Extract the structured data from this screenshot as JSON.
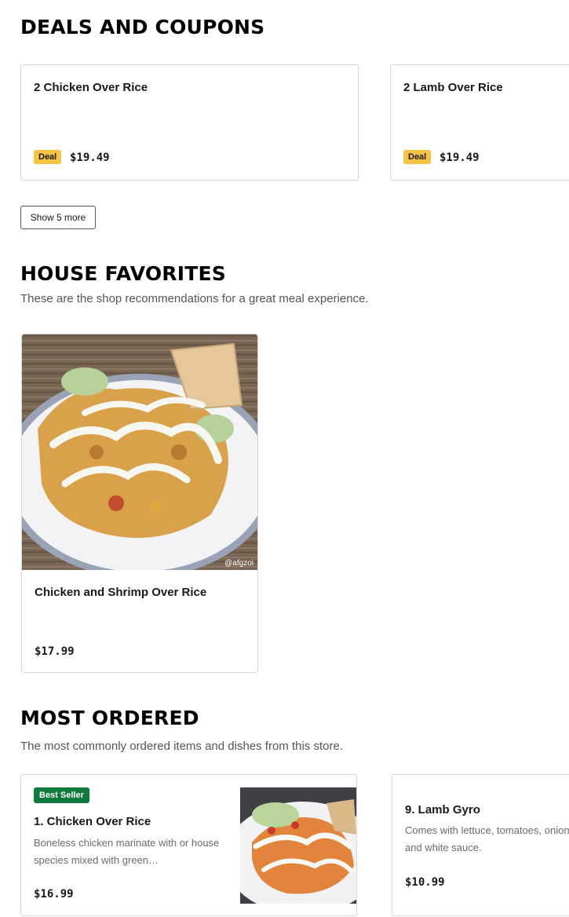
{
  "deals": {
    "title": "DEALS AND COUPONS",
    "items": [
      {
        "name": "2 Chicken Over Rice",
        "badge": "Deal",
        "price": "$19.49"
      },
      {
        "name": "2 Lamb Over Rice",
        "badge": "Deal",
        "price": "$19.49"
      }
    ],
    "show_more_label": "Show 5 more"
  },
  "house_favorites": {
    "title": "HOUSE FAVORITES",
    "subtitle": "These are the shop recommendations for a great meal experience.",
    "items": [
      {
        "name": "Chicken and Shrimp Over Rice",
        "price": "$17.99",
        "image_watermark": "@afgzoi"
      }
    ]
  },
  "most_ordered": {
    "title": "MOST ORDERED",
    "subtitle": "The most commonly ordered items and dishes from this store.",
    "items": [
      {
        "badge": "Best Seller",
        "name": "1. Chicken Over Rice",
        "description": "Boneless chicken marinate with or house species mixed with green…",
        "price": "$16.99"
      },
      {
        "name": "9. Lamb Gyro",
        "description": "Comes with lettuce, tomatoes, onions and white sauce.",
        "price": "$10.99"
      }
    ]
  },
  "colors": {
    "deal_badge": "#f6c343",
    "best_seller_badge": "#0f7a3c",
    "card_border": "#d6d6d6"
  }
}
